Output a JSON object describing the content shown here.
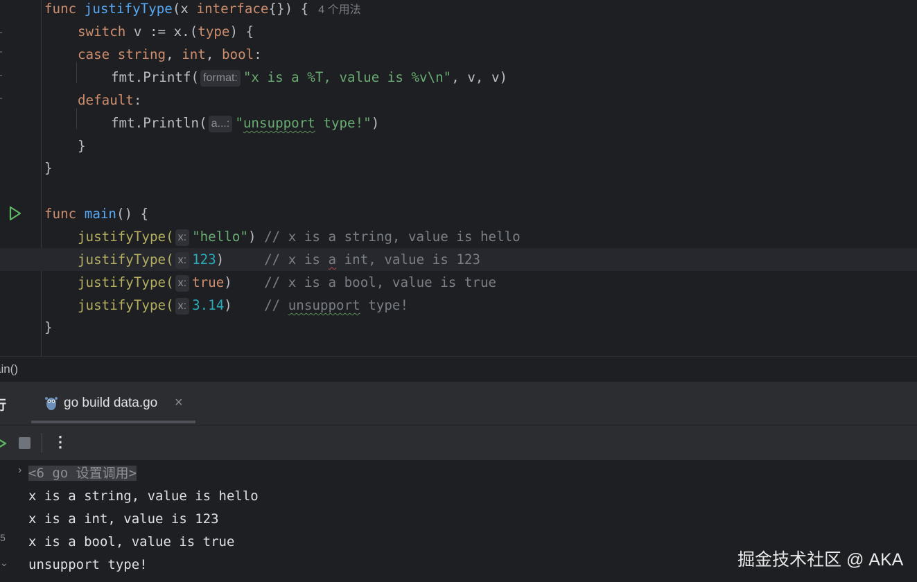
{
  "editor": {
    "usages_hint": "4 个用法",
    "lines": {
      "l1": {
        "kw": "func",
        "name": "justifyType",
        "open": "(x ",
        "iface": "interface",
        "close": "{}) {"
      },
      "l2": {
        "kw": "switch",
        "rest": " v := x.(",
        "type": "type",
        "end": ") {"
      },
      "l3": {
        "kw": "case",
        "t1": "string",
        "t2": "int",
        "t3": "bool",
        "end": ":"
      },
      "l4": {
        "call": "fmt.Printf(",
        "hint": "format:",
        "str": "\"x is a %T, value is %v\\n\"",
        "end": ", v, v)"
      },
      "l5": {
        "kw": "default",
        "end": ":"
      },
      "l6": {
        "call": "fmt.Println(",
        "hint": "a...:",
        "q1": "\"",
        "wavy": "unsupport",
        "rest": " type!\"",
        "end": ")"
      },
      "l7": {
        "text": "}"
      },
      "l8": {
        "text": "}"
      },
      "l10": {
        "kw": "func",
        "name": "main",
        "end": "() {"
      },
      "l11": {
        "call": "justifyType(",
        "hint": "x:",
        "arg": "\"hello\"",
        "end": ")",
        "comment": " // x is a string, value is hello"
      },
      "l12": {
        "call": "justifyType(",
        "hint": "x:",
        "arg": "123",
        "end": ")",
        "pad": "     ",
        "c1": "// x is ",
        "c2": "a",
        "c3": " int, value is 123"
      },
      "l13": {
        "call": "justifyType(",
        "hint": "x:",
        "arg": "true",
        "end": ")",
        "pad": "    ",
        "comment": "// x is a bool, value is true"
      },
      "l14": {
        "call": "justifyType(",
        "hint": "x:",
        "arg": "3.14",
        "end": ")",
        "pad": "    ",
        "c1": "// ",
        "c2": "unsupport",
        "c3": " type!"
      },
      "l15": {
        "text": "}"
      }
    }
  },
  "breadcrumb": {
    "label": "ain()"
  },
  "run_panel": {
    "title": "行",
    "tab_label": "go build data.go",
    "close_glyph": "×",
    "more_glyph": "⋮"
  },
  "console": {
    "collapsed": "<6 go 设置调用>",
    "lines": [
      "x is a string, value is hello",
      "x is a int, value is 123",
      "x is a bool, value is true",
      "unsupport type!"
    ]
  },
  "watermark": "掘金技术社区 @ AKA",
  "colors": {
    "background": "#1e1f22",
    "keyword": "#cf8e6d",
    "function": "#56a8f5",
    "string": "#6aab73",
    "number": "#2aacb8",
    "comment": "#7a7e85"
  }
}
